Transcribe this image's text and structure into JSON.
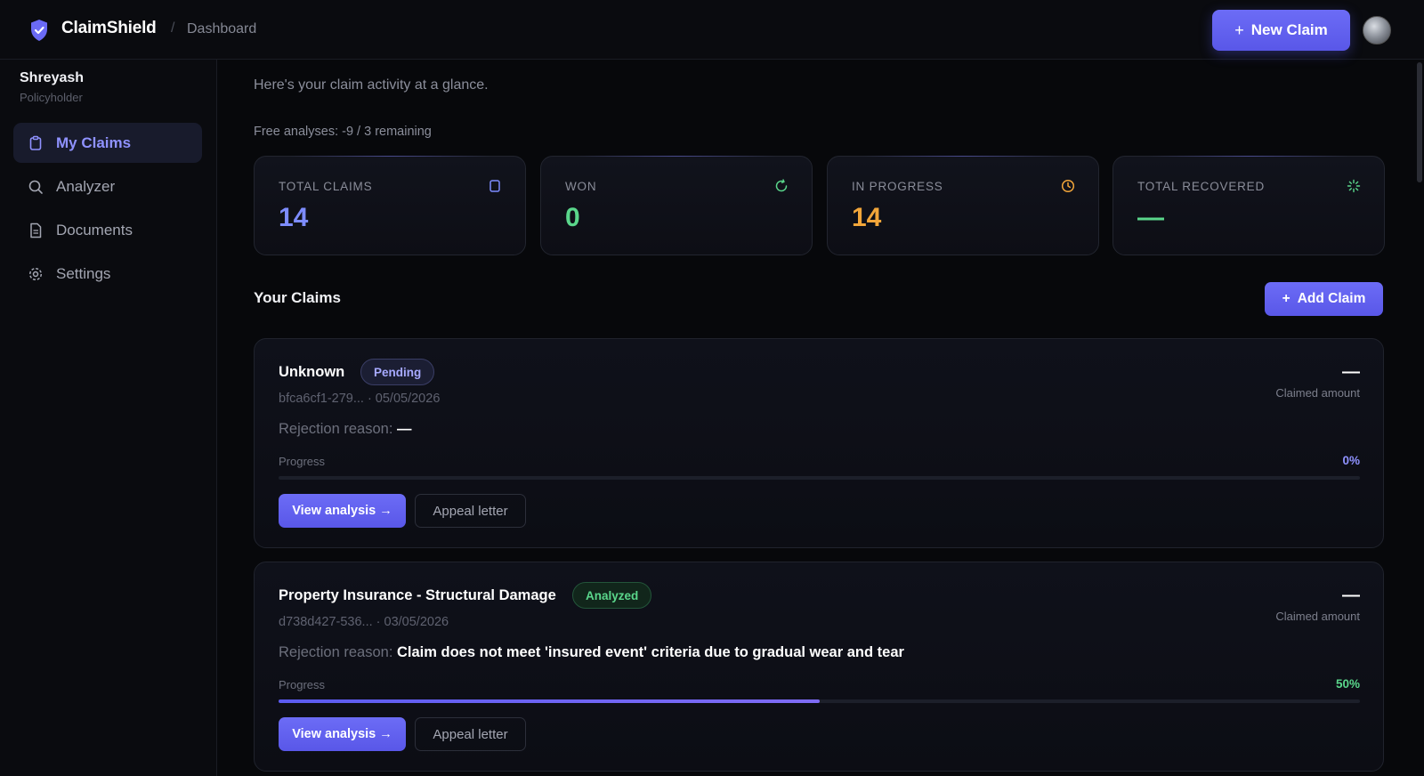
{
  "header": {
    "brand": "ClaimShield",
    "breadcrumb_separator": "/",
    "breadcrumb_page": "Dashboard",
    "new_claim_label": "New Claim",
    "plus_glyph": "+"
  },
  "user": {
    "name": "Shreyash",
    "role": "Policyholder"
  },
  "sidebar": {
    "items": [
      {
        "label": "My Claims",
        "icon": "clipboard-icon",
        "active": true
      },
      {
        "label": "Analyzer",
        "icon": "search-icon",
        "active": false
      },
      {
        "label": "Documents",
        "icon": "document-icon",
        "active": false
      },
      {
        "label": "Settings",
        "icon": "gear-icon",
        "active": false
      }
    ]
  },
  "main": {
    "subtitle": "Here's your claim activity at a glance.",
    "free_analyses": "Free analyses: -9 / 3 remaining",
    "stats": [
      {
        "label": "TOTAL CLAIMS",
        "value": "14",
        "icon": "clipboard-icon",
        "color": "#7d8cff"
      },
      {
        "label": "WON",
        "value": "0",
        "icon": "refresh-icon",
        "color": "#5ad68b"
      },
      {
        "label": "IN PROGRESS",
        "value": "14",
        "icon": "clock-icon",
        "color": "#f2a63a"
      },
      {
        "label": "TOTAL RECOVERED",
        "value": "—",
        "icon": "sparkle-icon",
        "color": "#5ad68b"
      }
    ],
    "section_title": "Your Claims",
    "add_claim_label": "Add Claim",
    "claims": [
      {
        "title": "Unknown",
        "status": "Pending",
        "meta": "bfca6cf1-279... · 05/05/2026",
        "amount": "—",
        "amount_label": "Claimed amount",
        "rejection_label": "Rejection reason: ",
        "rejection_value": "—",
        "progress_label": "Progress",
        "progress_text": "0%",
        "progress": 0,
        "progress_color": "#8f92ff",
        "view_label": "View analysis →",
        "appeal_label": "Appeal letter"
      },
      {
        "title": "Property Insurance - Structural Damage",
        "status": "Analyzed",
        "meta": "d738d427-536... · 03/05/2026",
        "amount": "—",
        "amount_label": "Claimed amount",
        "rejection_label": "Rejection reason: ",
        "rejection_value": "Claim does not meet 'insured event' criteria due to gradual wear and tear",
        "progress_label": "Progress",
        "progress_text": "50%",
        "progress": 0.5,
        "progress_color": "#5ad68b",
        "view_label": "View analysis →",
        "appeal_label": "Appeal letter"
      }
    ]
  },
  "colors": {
    "accent": "#5f5ef0",
    "background": "#07080b",
    "success": "#5ad68b",
    "warning": "#f2a63a"
  }
}
